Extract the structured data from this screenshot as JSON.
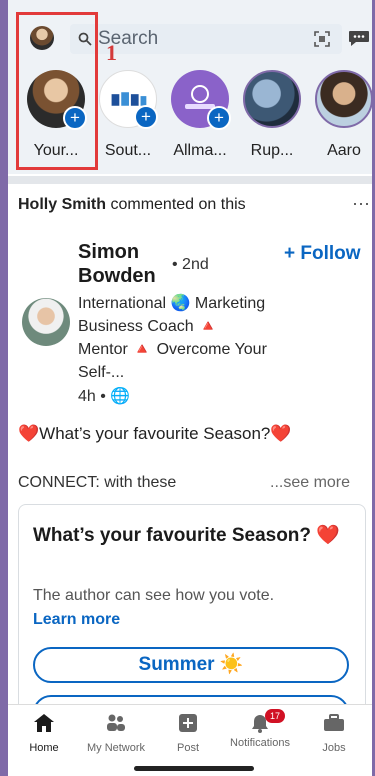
{
  "header": {
    "search_placeholder": "Search"
  },
  "stories": [
    {
      "label": "Your..."
    },
    {
      "label": "Sout..."
    },
    {
      "label": "Allma..."
    },
    {
      "label": "Rup..."
    },
    {
      "label": "Aaro"
    }
  ],
  "annotation_number": "1",
  "post": {
    "activity_name": "Holly Smith",
    "activity_text": "commented on this",
    "author_name": "Simon Bowden",
    "degree": "• 2nd",
    "follow_label": "+ Follow",
    "headline": "International 🌏 Marketing Business Coach 🔺 Mentor 🔺 Overcome Your Self-...",
    "time": "4h • 🌐",
    "text": "❤️What’s your favourite Season?❤️",
    "connect_text": "CONNECT: with these",
    "see_more": "...see more"
  },
  "poll": {
    "question": "What’s your favourite Season? ❤️",
    "note": "The author can see how you vote.",
    "learn_more": "Learn more",
    "option_1": "Summer ☀️"
  },
  "nav": {
    "home": "Home",
    "network": "My Network",
    "post": "Post",
    "notifications": "Notifications",
    "notifications_badge": "17",
    "jobs": "Jobs"
  },
  "colors": {
    "accent": "#0a66c2",
    "annotation": "#e23a3a",
    "background_outer": "#7f6aa8"
  }
}
